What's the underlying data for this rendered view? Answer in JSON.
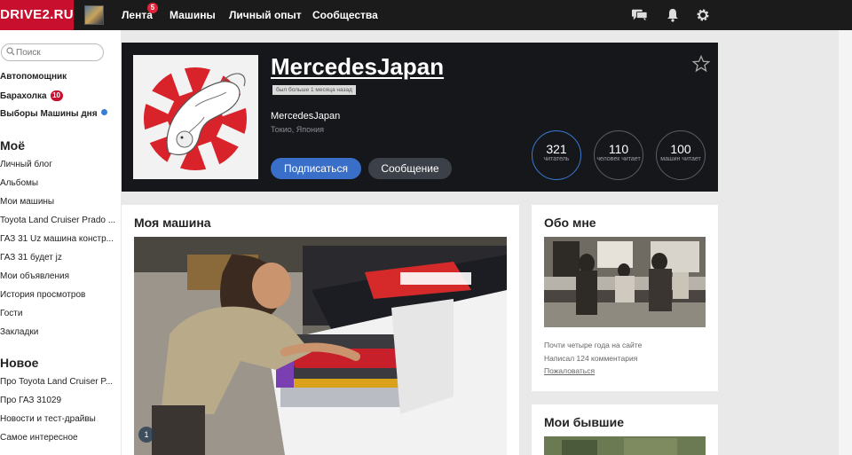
{
  "topbar": {
    "logo": "DRIVE2.RU",
    "nav": [
      {
        "label": "Лента",
        "badge": "5"
      },
      {
        "label": "Машины"
      },
      {
        "label": "Личный опыт"
      },
      {
        "label": "Сообщества"
      }
    ],
    "icons": [
      "chat-icon",
      "bell-icon",
      "gear-icon"
    ]
  },
  "sidebar": {
    "search_placeholder": "Поиск",
    "top_links": [
      {
        "label": "Автопомощник"
      },
      {
        "label": "Барахолка",
        "badge": "10"
      },
      {
        "label": "Выборы Машины дня"
      }
    ],
    "mine_heading": "Моё",
    "mine_links": [
      "Личный блог",
      "Альбомы",
      "Мои машины",
      "Toyota Land Cruiser Prado ...",
      "ГАЗ 31 Uz машина констр...",
      "ГАЗ 31 будет jz",
      "Мои объявления",
      "История просмотров",
      "Гости",
      "Закладки"
    ],
    "new_heading": "Новое",
    "new_links": [
      "Про Toyota Land Cruiser P...",
      "Про ГАЗ 31029",
      "Новости и тест-драйвы",
      "Самое интересное"
    ]
  },
  "profile": {
    "name": "MercedesJapan",
    "last_seen": "был больше 1 месяца назад",
    "login": "MercedesJapan",
    "city": "Токио, Япония",
    "subscribe_label": "Подписаться",
    "message_label": "Сообщение",
    "stats": [
      {
        "value": "321",
        "label": "читатель"
      },
      {
        "value": "110",
        "label": "человек читает"
      },
      {
        "value": "100",
        "label": "машин читает"
      }
    ]
  },
  "my_car": {
    "title": "Моя машина",
    "photo_index": "1"
  },
  "about": {
    "title": "Обо мне",
    "lines": [
      "Почти четыре года на сайте",
      "Написал 124 комментария"
    ],
    "report_label": "Пожаловаться"
  },
  "former": {
    "title": "Мои бывшие"
  },
  "colors": {
    "brand": "#c8102e",
    "accent": "#3a6fc9",
    "header_bg": "#15171b"
  }
}
